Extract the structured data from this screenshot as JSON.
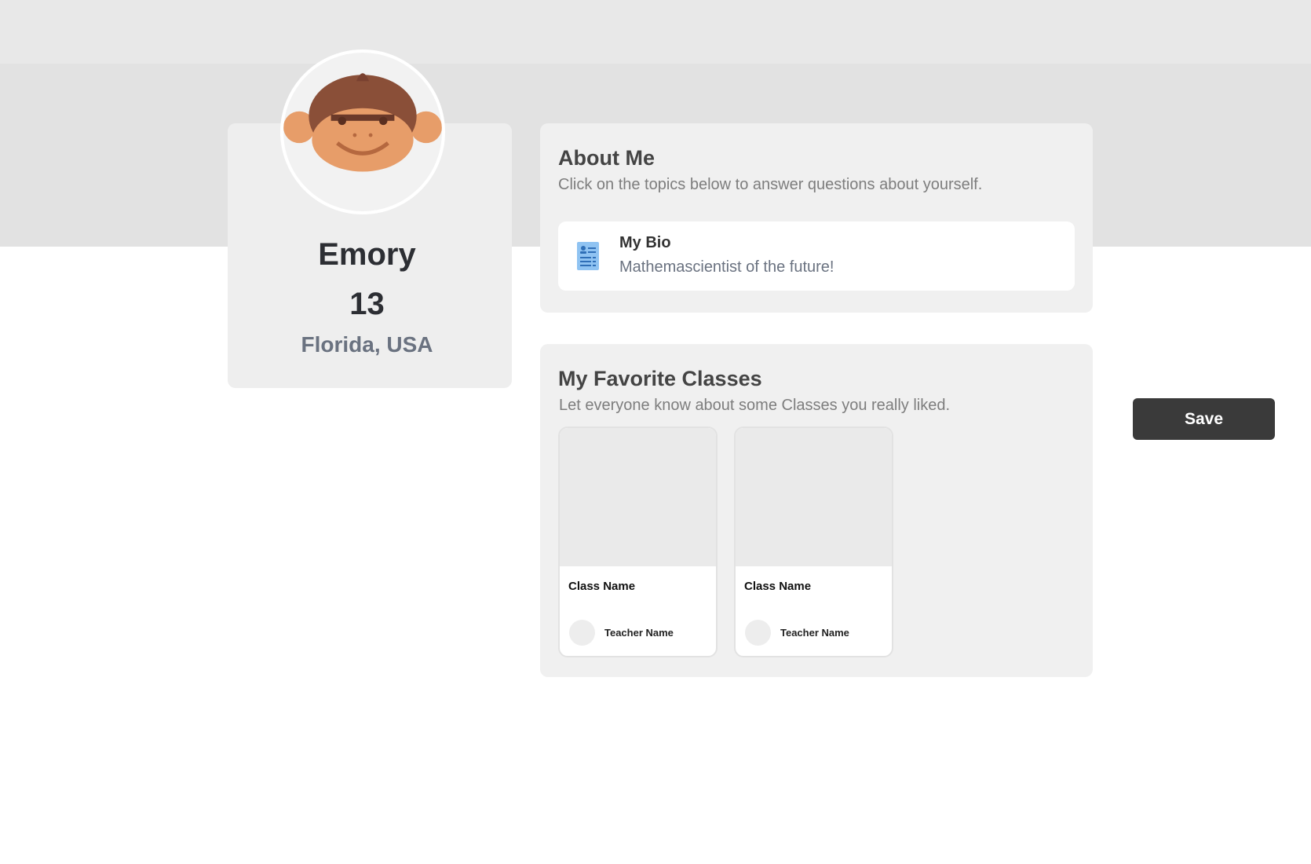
{
  "profile": {
    "name": "Emory",
    "age": "13",
    "location": "Florida, USA",
    "avatar_icon": "monkey-avatar-icon"
  },
  "about": {
    "title": "About Me",
    "subtitle": "Click on the topics below to answer questions about yourself.",
    "topics": [
      {
        "icon": "bio-document-icon",
        "title": "My Bio",
        "text": "Mathemascientist of the future!"
      }
    ]
  },
  "classes": {
    "title": "My Favorite Classes",
    "subtitle": "Let everyone know about some Classes you really liked.",
    "items": [
      {
        "name": "Class Name",
        "teacher": "Teacher Name"
      },
      {
        "name": "Class Name",
        "teacher": "Teacher Name"
      }
    ]
  },
  "actions": {
    "save_label": "Save"
  },
  "colors": {
    "banner": "#e2e2e2",
    "card": "#f0f0f0",
    "save_button": "#3a3a3a",
    "bio_icon": "#8fc3f2"
  }
}
